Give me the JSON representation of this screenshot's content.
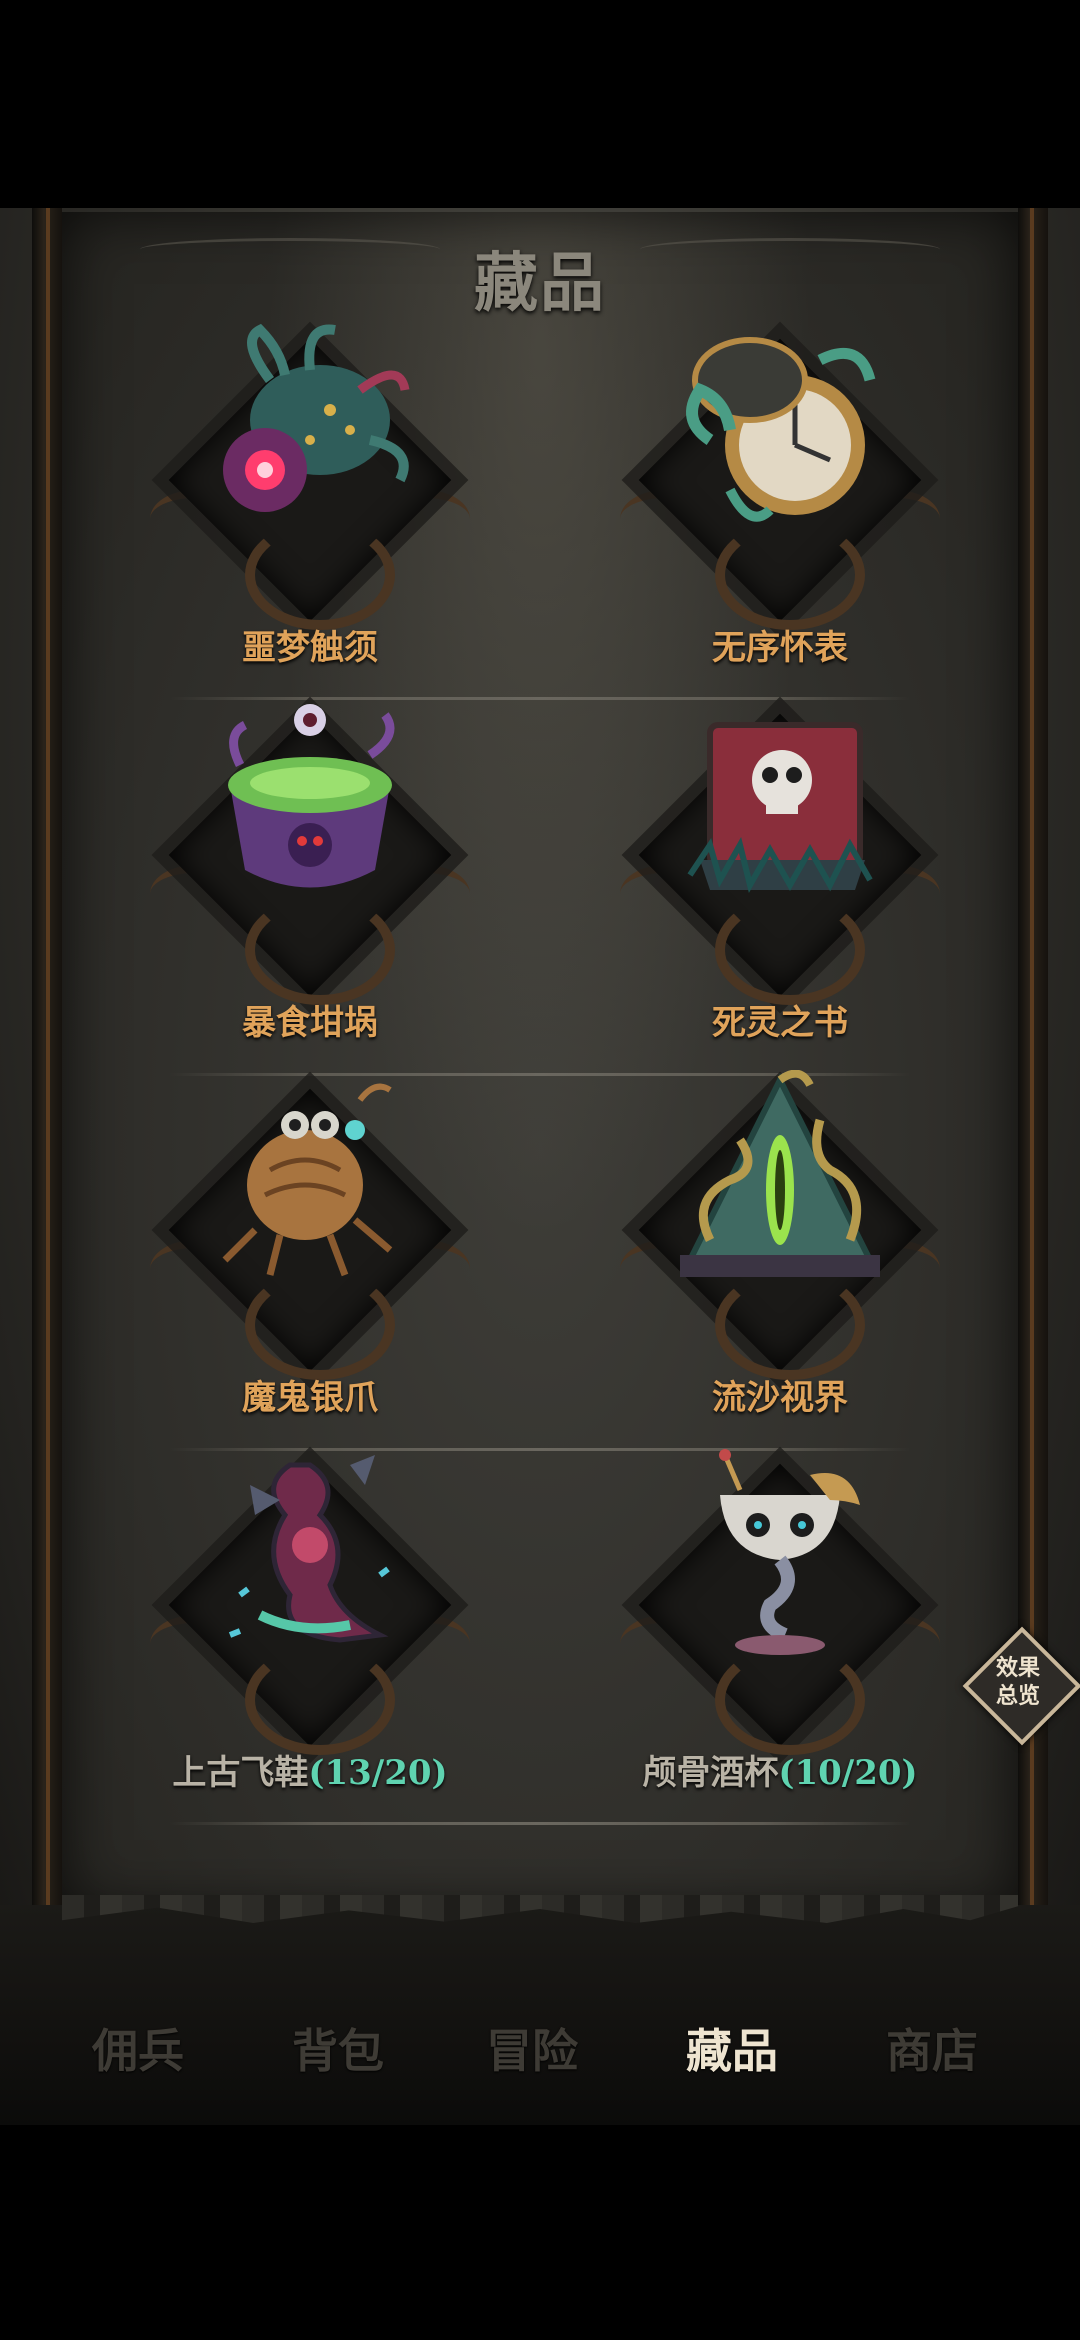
{
  "page": {
    "title": "藏品"
  },
  "collectibles": [
    {
      "name": "噩梦触须",
      "progress": "",
      "locked": false
    },
    {
      "name": "无序怀表",
      "progress": "",
      "locked": false
    },
    {
      "name": "暴食坩埚",
      "progress": "",
      "locked": false
    },
    {
      "name": "死灵之书",
      "progress": "",
      "locked": false
    },
    {
      "name": "魔鬼银爪",
      "progress": "",
      "locked": false
    },
    {
      "name": "流沙视界",
      "progress": "",
      "locked": false
    },
    {
      "name": "上古飞鞋",
      "progress": "(13/20)",
      "locked": true
    },
    {
      "name": "颅骨酒杯",
      "progress": "(10/20)",
      "locked": true
    }
  ],
  "effects_button": {
    "line1": "效果",
    "line2": "总览"
  },
  "nav": {
    "tabs": [
      {
        "label": "佣兵",
        "active": false
      },
      {
        "label": "背包",
        "active": false
      },
      {
        "label": "冒险",
        "active": false
      },
      {
        "label": "藏品",
        "active": true
      },
      {
        "label": "商店",
        "active": false
      }
    ]
  },
  "colors": {
    "label_unlocked": "#e0a35a",
    "label_locked": "#b9b3a6",
    "progress": "#5fd3b0",
    "nav_active": "#eee4d0",
    "nav_inactive": "#3e3b35"
  },
  "icons": [
    "nightmare-tentacle-icon",
    "chaos-pocketwatch-icon",
    "gluttony-crucible-icon",
    "necronomicon-icon",
    "devil-silver-claw-icon",
    "quicksand-vision-icon",
    "ancient-flying-shoe-icon",
    "skull-goblet-icon"
  ]
}
